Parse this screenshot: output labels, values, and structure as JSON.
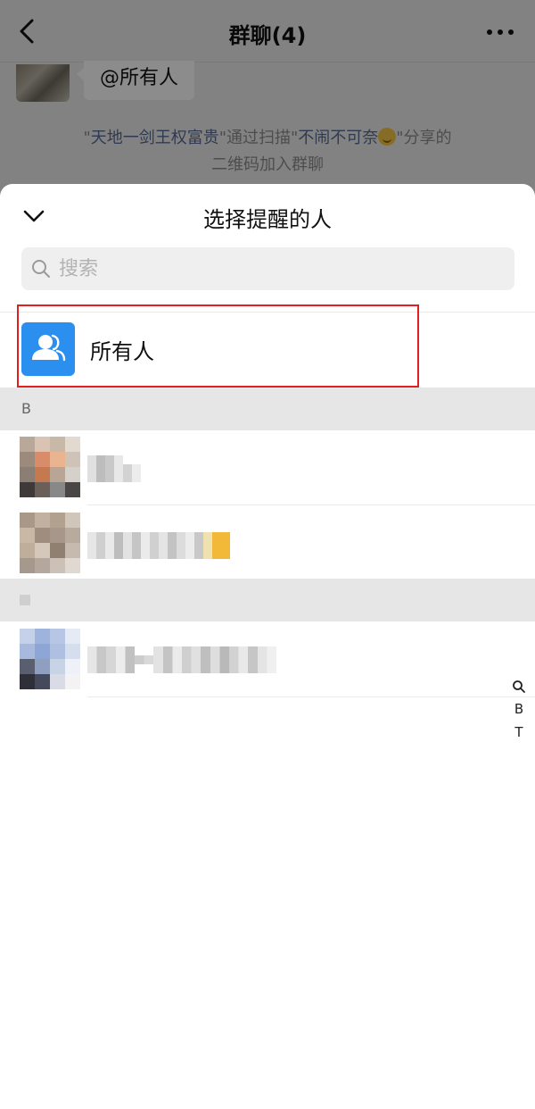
{
  "chat": {
    "title": "群聊(4)",
    "message": "@所有人",
    "system_message": {
      "quote_open": "\"",
      "inviter": "天地一剑王权富贵",
      "mid1": "\"通过扫描\"",
      "sharer": "不闹不可奈",
      "mid2": "\"分享的",
      "line2": "二维码加入群聊"
    }
  },
  "sheet": {
    "title": "选择提醒的人",
    "search_placeholder": "搜索",
    "everyone_label": "所有人"
  },
  "sections": [
    {
      "letter": "B"
    },
    {
      "letter": ""
    }
  ],
  "index_bar": {
    "letters": [
      "B",
      "T"
    ]
  },
  "colors": {
    "accent_blue": "#2b8ff0",
    "highlight_red": "#e02020",
    "link_blue": "#576b95",
    "section_bg": "#e6e6e6"
  },
  "icons": {
    "back": "chevron-left-icon",
    "more": "more-dots-icon",
    "collapse": "chevron-down-icon",
    "search": "search-icon",
    "everyone": "group-people-icon"
  }
}
